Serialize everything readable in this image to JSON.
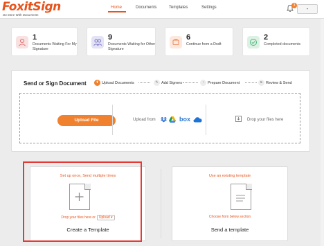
{
  "header": {
    "logo_text_a": "Foxit",
    "logo_text_b": "Sign",
    "logo_tagline": "Do More With Documents",
    "nav": [
      {
        "label": "Home",
        "active": true
      },
      {
        "label": "Documents",
        "active": false
      },
      {
        "label": "Templates",
        "active": false
      },
      {
        "label": "Settings",
        "active": false
      }
    ],
    "notification_count": "3",
    "user_menu_label": "-"
  },
  "cards": [
    {
      "count": "1",
      "label": "Documents Waiting For My Signature",
      "icon": "user-icon",
      "color": "#f8e1e1"
    },
    {
      "count": "9",
      "label": "Documents Waiting for Other Signature",
      "icon": "users-icon",
      "color": "#e4e3f5"
    },
    {
      "count": "6",
      "label": "Continue from a Draft",
      "icon": "draft-icon",
      "color": "#fde8dd"
    },
    {
      "count": "2",
      "label": "Completed documents",
      "icon": "check-icon",
      "color": "#dcf1e4"
    }
  ],
  "send_sign": {
    "title": "Send or Sign Document",
    "steps": [
      {
        "label": "Upload Documents",
        "active": true
      },
      {
        "label": "Add Signers",
        "active": false
      },
      {
        "label": "Prepare Document",
        "active": false
      },
      {
        "label": "Review & Send",
        "active": false
      }
    ],
    "upload_button": "Upload File",
    "upload_from": "Upload from",
    "box_label": "box",
    "drop_files": "Drop your files here"
  },
  "templates": {
    "create": {
      "caption": "Set up once, Send multiple times",
      "sub": "Drop your files here or",
      "upload_label": "Upload ▾",
      "title": "Create a Template"
    },
    "send": {
      "caption": "Use an existing template",
      "sub": "Choose from below section",
      "title": "Send a template"
    }
  },
  "colors": {
    "accent": "#e8531c",
    "button": "#f0812f",
    "highlight": "#e53935"
  }
}
